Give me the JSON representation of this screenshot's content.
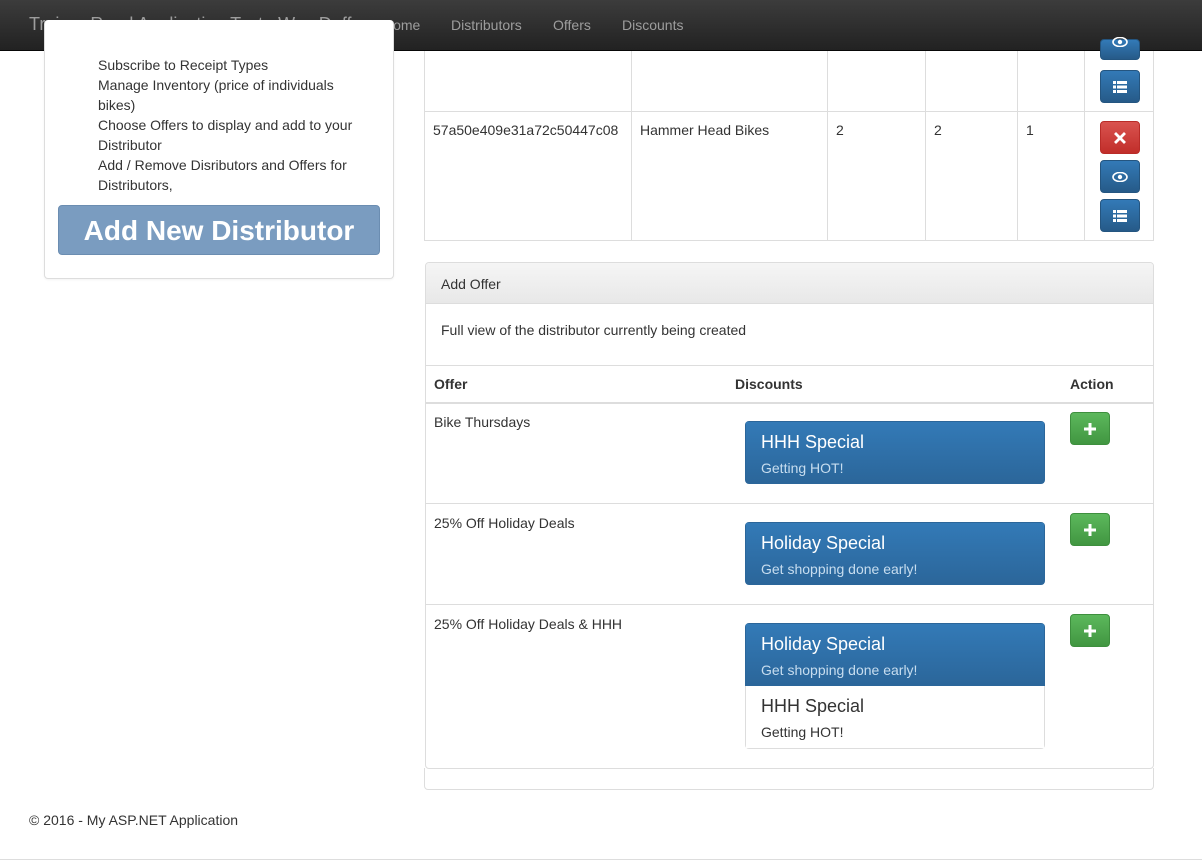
{
  "navbar": {
    "brand": "Trainer Road Application Test : Wes Duff",
    "links": [
      "Home",
      "Distributors",
      "Offers",
      "Discounts"
    ]
  },
  "sidebar": {
    "lines": [
      "Subscribe to Receipt Types",
      "Manage Inventory (price of individuals",
      "bikes)",
      "Choose Offers to display and add to your",
      "Distributor",
      "Add / Remove Disributors and Offers for",
      "Distributors,"
    ],
    "add_button": "Add New Distributor"
  },
  "distributor_row": {
    "id": "57a50e409e31a72c50447c08",
    "name": "Hammer Head Bikes",
    "col3": "2",
    "col4": "2",
    "col5": "1"
  },
  "offer_panel": {
    "heading": "Add Offer",
    "body": "Full view of the distributor currently being created",
    "columns": [
      "Offer",
      "Discounts",
      "Action"
    ],
    "rows": [
      {
        "offer": "Bike Thursdays",
        "discounts": [
          {
            "title": "HHH Special",
            "text": "Getting HOT!"
          }
        ]
      },
      {
        "offer": "25% Off Holiday Deals",
        "discounts": [
          {
            "title": "Holiday Special",
            "text": "Get shopping done early!"
          }
        ]
      },
      {
        "offer": "25% Off Holiday Deals & HHH",
        "discounts": [
          {
            "title": "Holiday Special",
            "text": "Get shopping done early!"
          },
          {
            "title": "HHH Special",
            "text": "Getting HOT!"
          }
        ]
      }
    ]
  },
  "footer": {
    "text": "© 2016 - My ASP.NET Application"
  },
  "icons": {
    "delete": "remove-icon",
    "view": "eye-icon",
    "list": "list-icon",
    "add": "plus-icon"
  },
  "colors": {
    "primary": "#337ab7",
    "danger": "#d9534f",
    "success": "#5cb85c",
    "add_distributor_button": "#7a9cc0"
  }
}
